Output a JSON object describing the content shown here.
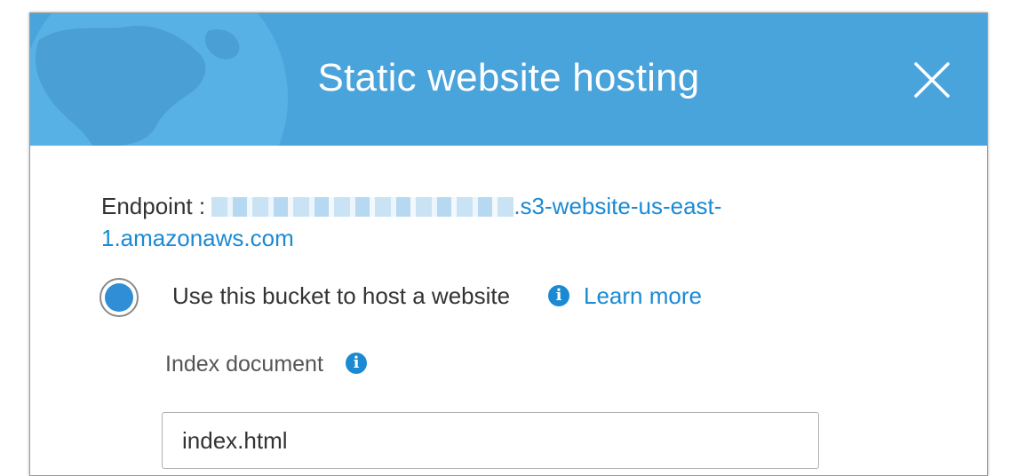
{
  "modal": {
    "title": "Static website hosting",
    "close_icon": "close-icon",
    "header_color": "#4aa4dc"
  },
  "endpoint": {
    "label": "Endpoint :",
    "url_visible": ".s3-website-us-east-1.amazonaws.com",
    "link_color": "#1b8ad3"
  },
  "hosting_option": {
    "label": "Use this bucket to host a website",
    "selected": true,
    "info_icon": "info-icon",
    "learn_more": "Learn more"
  },
  "index_document": {
    "label": "Index document",
    "info_icon": "info-icon",
    "value": "index.html"
  }
}
